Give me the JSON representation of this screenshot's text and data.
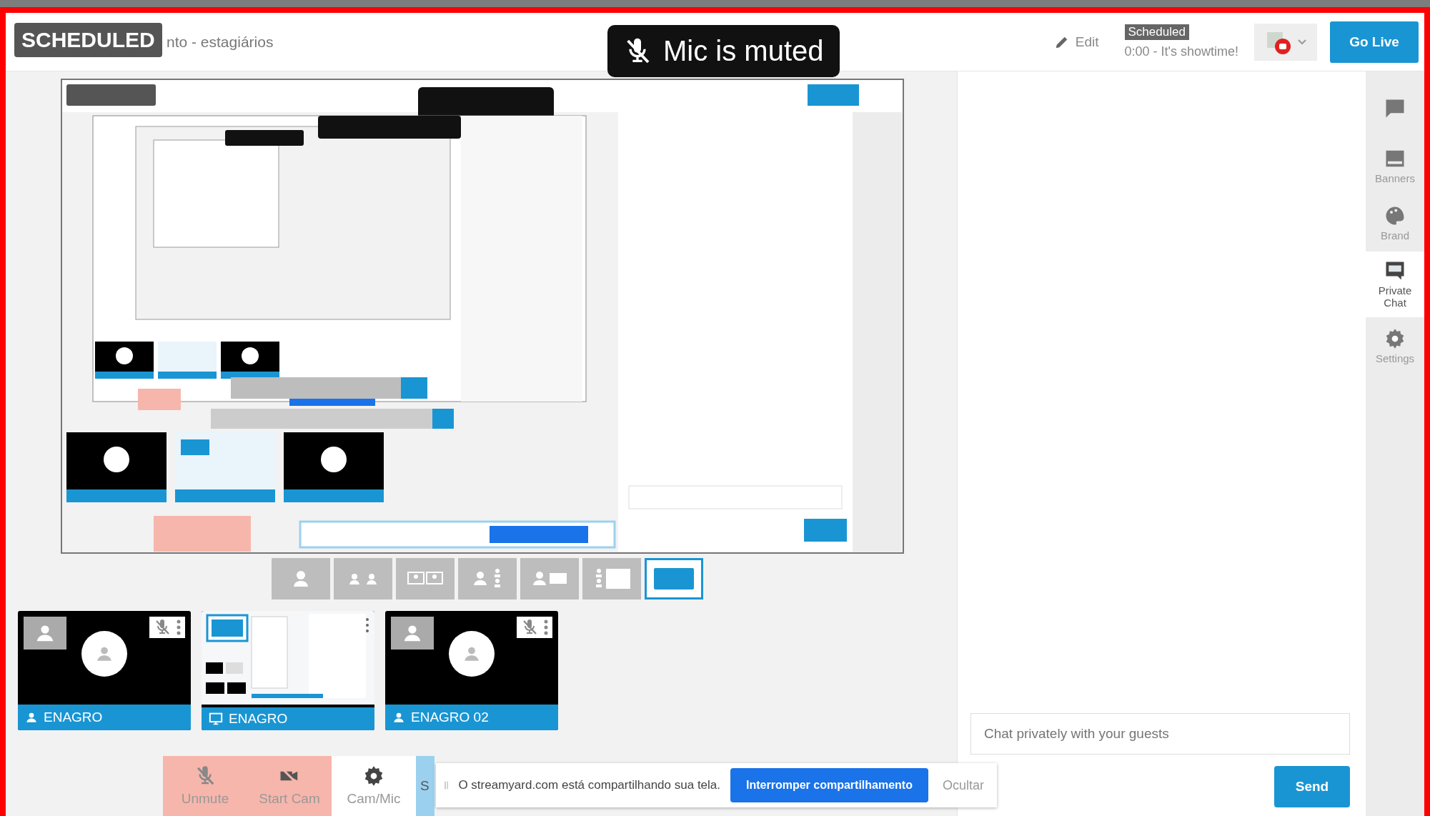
{
  "header": {
    "badge": "SCHEDULED",
    "title": "nto - estagiários",
    "edit": "Edit",
    "status_badge": "Scheduled",
    "status_text": "0:00 - It's showtime!",
    "go_live": "Go Live"
  },
  "toast": {
    "text": "Mic is muted"
  },
  "layouts": [
    {
      "kind": "solo",
      "selected": false
    },
    {
      "kind": "split",
      "selected": false
    },
    {
      "kind": "thin",
      "selected": false
    },
    {
      "kind": "group",
      "selected": false
    },
    {
      "kind": "leader",
      "selected": false
    },
    {
      "kind": "sidebar",
      "selected": false
    },
    {
      "kind": "full",
      "selected": true
    }
  ],
  "participants": [
    {
      "name": "ENAGRO",
      "kind": "camera"
    },
    {
      "name": "ENAGRO",
      "kind": "screen"
    },
    {
      "name": "ENAGRO 02",
      "kind": "camera"
    }
  ],
  "controls": [
    {
      "label": "Unmute",
      "kind": "mic",
      "off": true
    },
    {
      "label": "Start Cam",
      "kind": "cam",
      "off": true
    },
    {
      "label": "Cam/Mic",
      "kind": "settings",
      "off": false
    },
    {
      "label": "S",
      "kind": "share"
    }
  ],
  "share_notice": {
    "text": "O streamyard.com está compartilhando sua tela.",
    "stop": "Interromper compartilhamento",
    "hide": "Ocultar"
  },
  "chat": {
    "placeholder": "Chat privately with your guests",
    "send": "Send"
  },
  "sidebar": [
    {
      "kind": "comments",
      "selected": false
    },
    {
      "kind": "banners",
      "label": "Banners",
      "selected": false
    },
    {
      "kind": "brand",
      "label": "Brand",
      "selected": false
    },
    {
      "kind": "private_chat",
      "label": "Private Chat",
      "selected": true
    },
    {
      "kind": "settings",
      "label": "Settings",
      "selected": false
    }
  ]
}
